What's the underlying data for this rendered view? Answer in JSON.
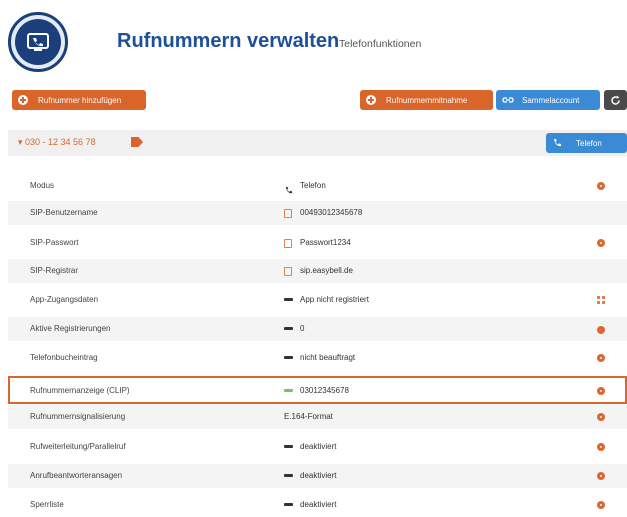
{
  "header": {
    "title": "Rufnummern verwalten",
    "subtitle": "Telefonfunktionen",
    "logo_icon": "telephone-screen-icon"
  },
  "toolbar": {
    "add_number_label": "Rufnummer hinzufügen",
    "porting_label": "Rufnummernmitnahme",
    "trunk_label": "Sammelaccount"
  },
  "number_bar": {
    "number": "▾ 030 - 12 34 56 78",
    "phone_button_label": "Telefon"
  },
  "rows": [
    {
      "label": "Modus",
      "value": "Telefon"
    },
    {
      "label": "SIP-Benutzername",
      "value": "00493012345678"
    },
    {
      "label": "SIP-Passwort",
      "value": "Passwort1234"
    },
    {
      "label": "SIP-Registrar",
      "value": "sip.easybell.de"
    },
    {
      "label": "App-Zugangsdaten",
      "value": "App nicht registriert"
    },
    {
      "label": "Aktive Registrierungen",
      "value": "0"
    },
    {
      "label": "Telefonbucheintrag",
      "value": "nicht beauftragt"
    },
    {
      "label": "Rufnummernanzeige (CLIP)",
      "value": "03012345678"
    },
    {
      "label": "Rufnummernsignalisierung",
      "value": "E.164-Format"
    },
    {
      "label": "Rufweiterleitung/Parallelruf",
      "value": "deaktiviert"
    },
    {
      "label": "Anrufbeantworteransagen",
      "value": "deaktiviert"
    },
    {
      "label": "Sperrliste",
      "value": "deaktiviert"
    }
  ],
  "colors": {
    "accent_orange": "#d9652b",
    "accent_blue": "#3b8ad6",
    "title_blue": "#1e4f9a",
    "status_green": "#7fc15a"
  }
}
